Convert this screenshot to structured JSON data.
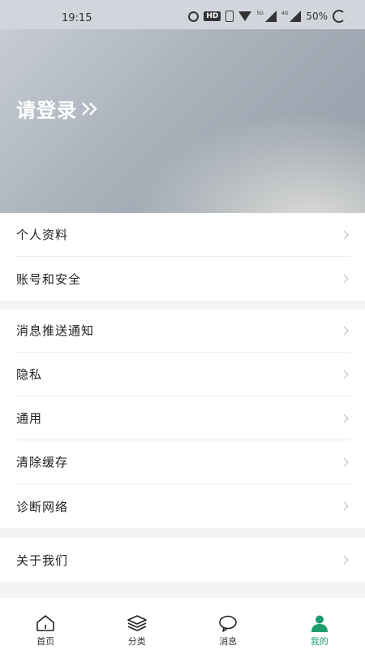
{
  "status_bar": {
    "time": "19:15",
    "hd_label": "HD",
    "network_label_1": "5G",
    "network_label_2": "4G",
    "battery": "50%"
  },
  "header": {
    "login_label": "请登录"
  },
  "groups": [
    {
      "items": [
        {
          "label": "个人资料"
        },
        {
          "label": "账号和安全"
        }
      ]
    },
    {
      "items": [
        {
          "label": "消息推送通知"
        },
        {
          "label": "隐私"
        },
        {
          "label": "通用"
        },
        {
          "label": "清除缓存"
        },
        {
          "label": "诊断网络"
        }
      ]
    },
    {
      "items": [
        {
          "label": "关于我们"
        }
      ]
    }
  ],
  "tabbar": {
    "items": [
      {
        "label": "首页",
        "icon": "home-icon"
      },
      {
        "label": "分类",
        "icon": "layers-icon"
      },
      {
        "label": "消息",
        "icon": "chat-bubble-icon"
      },
      {
        "label": "我的",
        "icon": "user-icon",
        "active": true
      }
    ]
  },
  "colors": {
    "accent": "#1f9e6f",
    "hero_start": "#c7ccd3",
    "hero_end": "#939da7"
  }
}
